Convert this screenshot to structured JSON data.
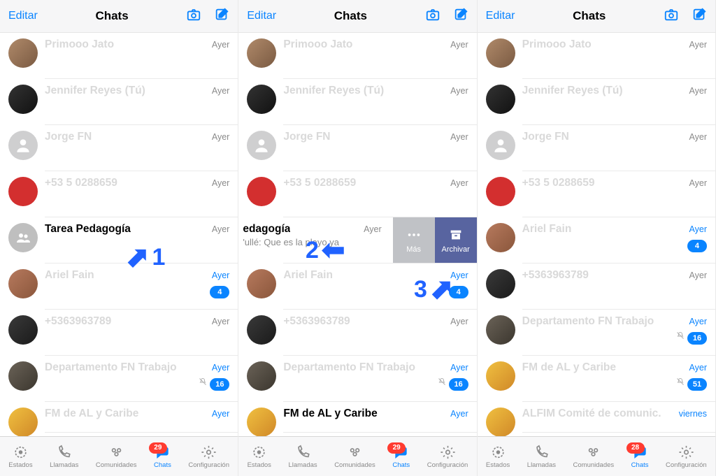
{
  "topbar": {
    "edit": "Editar",
    "title": "Chats"
  },
  "swipe": {
    "more": "Más",
    "archive": "Archivar"
  },
  "rows_common": {
    "primo": {
      "name": "Primooo Jato",
      "time": "Ayer"
    },
    "jen": {
      "name": "Jennifer Reyes (Tú)",
      "time": "Ayer"
    },
    "jorge": {
      "name": "Jorge FN",
      "time": "Ayer"
    },
    "phone": {
      "name": "+53 5 0288659",
      "time": "Ayer"
    },
    "tarea": {
      "name": "Tarea Pedagogía",
      "time": "Ayer"
    },
    "pedagogia_swiped": {
      "name": "edagogía",
      "sub": "'ullé: Que es la playo ya",
      "time": "Ayer"
    },
    "ariel": {
      "name": "Ariel Fain",
      "time": "Ayer",
      "badge": "4"
    },
    "phone2": {
      "name": "+5363963789",
      "time": "Ayer"
    },
    "dept": {
      "name": "Departamento FN Trabajo",
      "time": "Ayer",
      "badge": "16"
    },
    "fm": {
      "name": "FM de AL y Caribe",
      "time": "Ayer",
      "badge": "51"
    },
    "alfim": {
      "name": "ALFIM Comité de comunic.",
      "time": "viernes"
    }
  },
  "tabs": {
    "estados": "Estados",
    "llamadas": "Llamadas",
    "comunidades": "Comunidades",
    "chats": "Chats",
    "config": "Configuración",
    "badge_29": "29",
    "badge_28": "28"
  },
  "annotations": {
    "one": "1",
    "two": "2",
    "three": "3"
  }
}
